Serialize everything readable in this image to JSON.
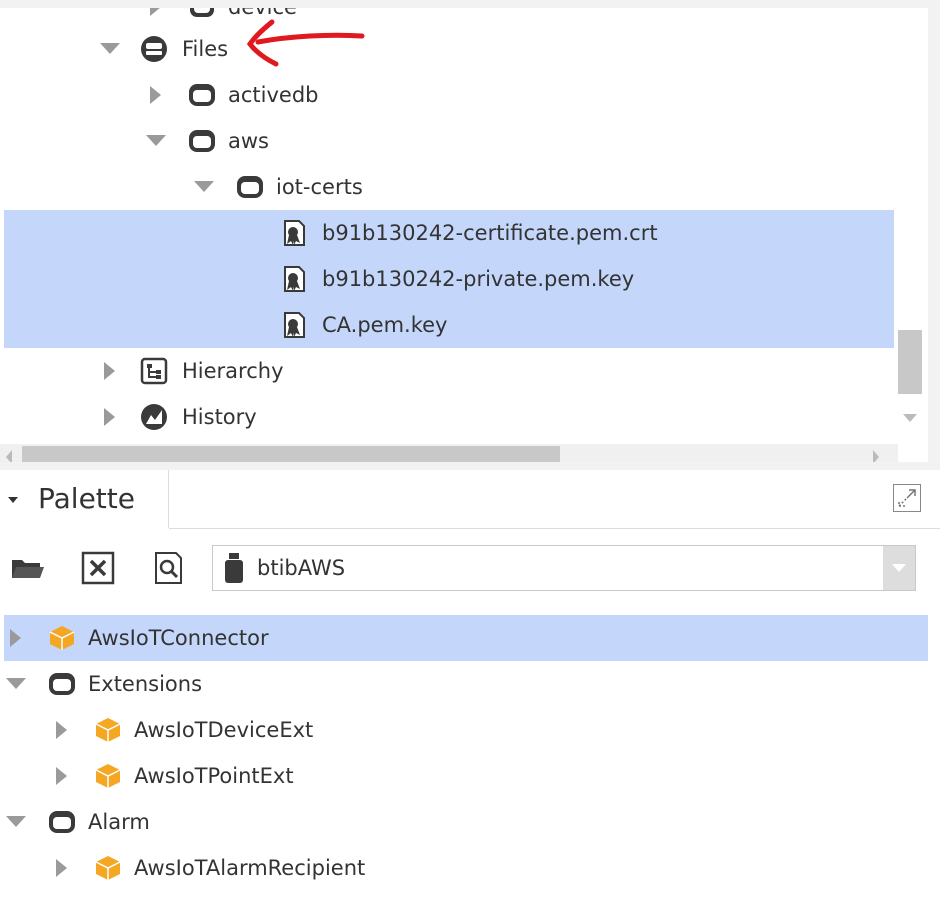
{
  "nav_tree": {
    "partial_top_label": "device",
    "items": [
      {
        "label": "Files"
      },
      {
        "label": "activedb"
      },
      {
        "label": "aws"
      },
      {
        "label": "iot-certs"
      },
      {
        "label": "b91b130242-certificate.pem.crt"
      },
      {
        "label": "b91b130242-private.pem.key"
      },
      {
        "label": "CA.pem.key"
      },
      {
        "label": "Hierarchy"
      },
      {
        "label": "History"
      }
    ],
    "selected_color": "#c4d7fb",
    "annotation_color": "#e0191e"
  },
  "palette": {
    "title": "Palette",
    "module_select_value": "btibAWS",
    "items": [
      {
        "label": "AwsIoTConnector"
      },
      {
        "label": "Extensions"
      },
      {
        "label": "AwsIoTDeviceExt"
      },
      {
        "label": "AwsIoTPointExt"
      },
      {
        "label": "Alarm"
      },
      {
        "label": "AwsIoTAlarmRecipient"
      }
    ],
    "component_icon_color": "#f5a623"
  }
}
